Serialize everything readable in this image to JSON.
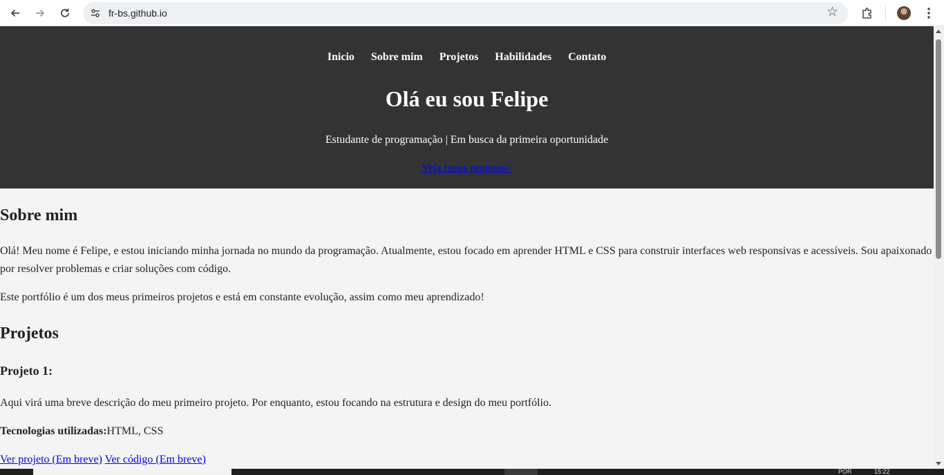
{
  "browser": {
    "url": "fr-bs.github.io"
  },
  "nav": {
    "items": [
      "Inicio",
      "Sobre mim",
      "Projetos",
      "Habilidades",
      "Contato"
    ]
  },
  "hero": {
    "title": "Olá eu sou Felipe",
    "tagline": "Estudante de programação | Em busca da primeira oportunidade",
    "cta": "Veja meus projetos>"
  },
  "about": {
    "heading": "Sobre mim",
    "paragraph1": "Olá! Meu nome é Felipe, e estou iniciando minha jornada no mundo da programação. Atualmente, estou focado em aprender HTML e CSS para construir interfaces web responsivas e acessíveis. Sou apaixonado por resolver problemas e criar soluções com código.",
    "paragraph2": "Este portfólio é um dos meus primeiros projetos e está em constante evolução, assim como meu aprendizado!"
  },
  "projects": {
    "heading": "Projetos",
    "project1": {
      "title": "Projeto 1:",
      "description": "Aqui virá uma breve descrição do meu primeiro projeto. Por enquanto, estou focando na estrutura e design do meu portfólio.",
      "tech_label": "Tecnologias utilizadas:",
      "tech_value": "HTML, CSS",
      "view_link": "Ver projeto (Em breve)",
      "code_link": "Ver código (Em breve)"
    }
  },
  "taskbar": {
    "tray_lang": "POR",
    "tray_time": "15:22"
  },
  "icons": {
    "back": "arrow-left-icon",
    "forward": "arrow-right-icon",
    "reload": "reload-icon",
    "site_settings": "tune-icon",
    "bookmark": "star-icon",
    "extensions": "puzzle-icon",
    "menu": "kebab-menu-icon"
  },
  "colors": {
    "hero_bg": "#333333",
    "page_bg": "#f4f4f4",
    "link": "#0000ee"
  }
}
